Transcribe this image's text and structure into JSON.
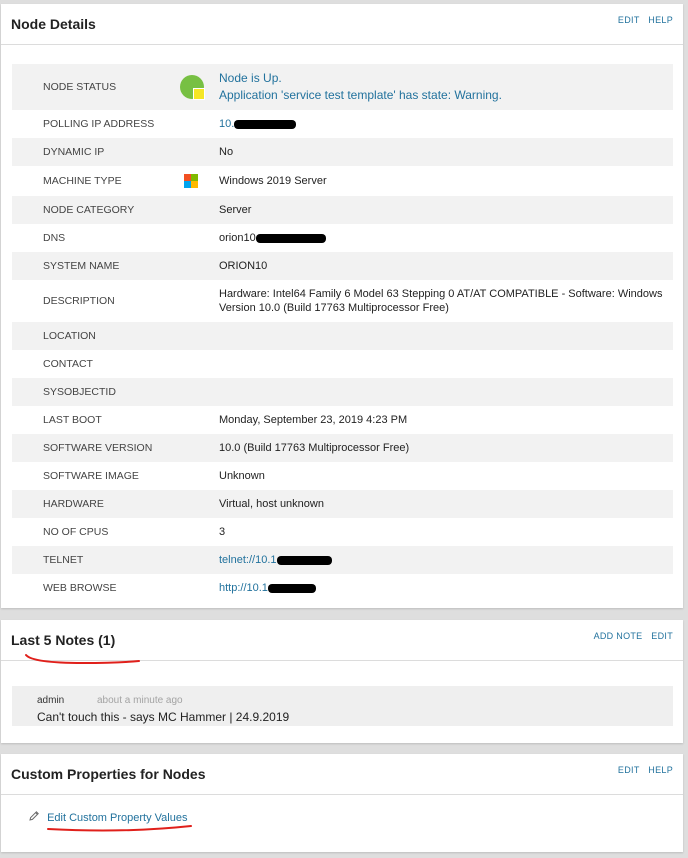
{
  "node_details": {
    "title": "Node Details",
    "actions": [
      "EDIT",
      "HELP"
    ],
    "status_lines": [
      "Node is Up.",
      "Application 'service test template' has state: Warning."
    ],
    "rows": [
      {
        "label": "POLLING IP ADDRESS",
        "value": "10.",
        "kind": "link",
        "redact": 62
      },
      {
        "label": "DYNAMIC IP",
        "value": "No"
      },
      {
        "label": "MACHINE TYPE",
        "value": "Windows 2019 Server",
        "icon": "windows-icon"
      },
      {
        "label": "NODE CATEGORY",
        "value": "Server"
      },
      {
        "label": "DNS",
        "value": "orion10",
        "redact": 70
      },
      {
        "label": "SYSTEM NAME",
        "value": "ORION10"
      },
      {
        "label": "DESCRIPTION",
        "value": "Hardware: Intel64 Family 6 Model 63 Stepping 0 AT/AT COMPATIBLE - Software: Windows Version 10.0 (Build 17763 Multiprocessor Free)"
      },
      {
        "label": "LOCATION",
        "value": ""
      },
      {
        "label": "CONTACT",
        "value": ""
      },
      {
        "label": "SYSOBJECTID",
        "value": ""
      },
      {
        "label": "LAST BOOT",
        "value": "Monday, September 23, 2019 4:23 PM"
      },
      {
        "label": "SOFTWARE VERSION",
        "value": "10.0 (Build 17763 Multiprocessor Free)"
      },
      {
        "label": "SOFTWARE IMAGE",
        "value": "Unknown"
      },
      {
        "label": "HARDWARE",
        "value": "Virtual, host unknown"
      },
      {
        "label": "NO OF CPUS",
        "value": "3"
      },
      {
        "label": "TELNET",
        "value": "telnet://10.1",
        "kind": "link",
        "redact": 55
      },
      {
        "label": "WEB BROWSE",
        "value": "http://10.1",
        "kind": "link",
        "redact": 48
      }
    ]
  },
  "notes": {
    "title": "Last 5 Notes (1)",
    "actions": [
      "ADD NOTE",
      "EDIT"
    ],
    "note": {
      "author": "admin",
      "time": "about a minute ago",
      "text": "Can't touch this - says MC Hammer | 24.9.2019"
    }
  },
  "custom_props": {
    "title": "Custom Properties for Nodes",
    "actions": [
      "EDIT",
      "HELP"
    ],
    "edit_link": "Edit Custom Property Values"
  },
  "colors": {
    "link": "#22729d",
    "status_up": "#77c043",
    "warning": "#f5e625",
    "scribble": "#e0201b"
  },
  "windows_logo_colors": [
    "#f25022",
    "#7fba00",
    "#00a4ef",
    "#ffb900"
  ]
}
